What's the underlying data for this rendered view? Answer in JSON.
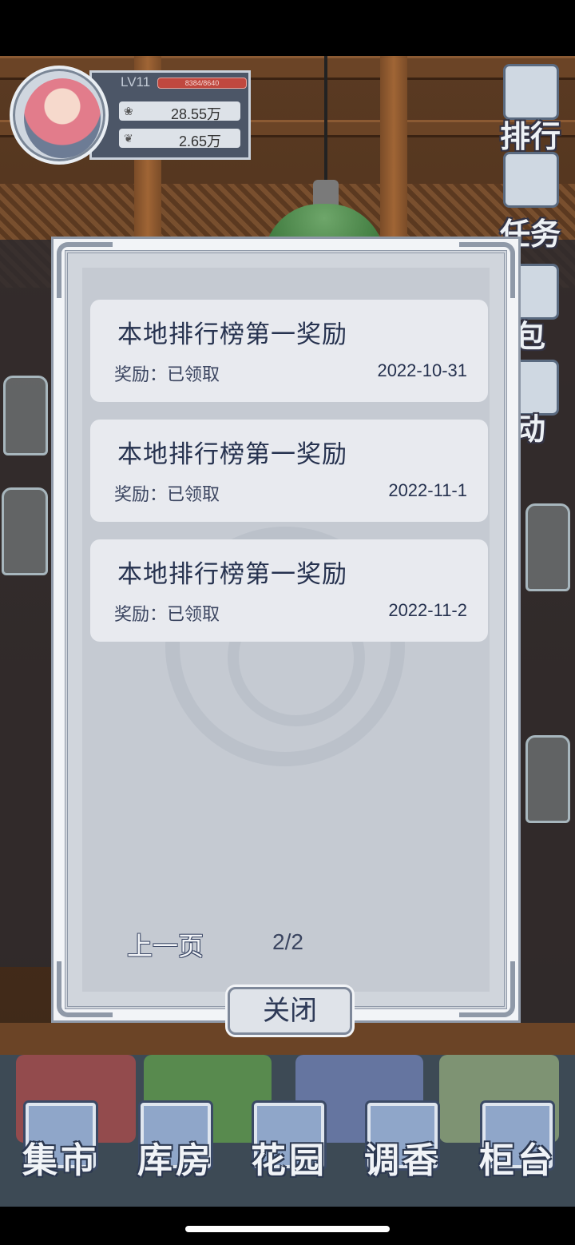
{
  "hud": {
    "level": "LV11",
    "xp_text": "8384/8640",
    "xp_fraction": 0.97,
    "currency_1": "28.55万",
    "currency_2": "2.65万"
  },
  "side_menu": [
    {
      "label": "排行",
      "icon": "trophy-icon"
    },
    {
      "label": "任务",
      "icon": "clipboard-icon"
    },
    {
      "label": "包",
      "icon": "bag-icon"
    },
    {
      "label": "动",
      "icon": "event-icon"
    }
  ],
  "dialog": {
    "items": [
      {
        "title": "本地排行榜第一奖励",
        "status": "奖励：已领取",
        "date": "2022-10-31"
      },
      {
        "title": "本地排行榜第一奖励",
        "status": "奖励：已领取",
        "date": "2022-11-1"
      },
      {
        "title": "本地排行榜第一奖励",
        "status": "奖励：已领取",
        "date": "2022-11-2"
      }
    ],
    "prev_page": "上一页",
    "page_indicator": "2/2",
    "close_label": "关闭"
  },
  "bottom_nav": [
    {
      "label": "集市",
      "icon": "market-gate-icon"
    },
    {
      "label": "库房",
      "icon": "warehouse-icon"
    },
    {
      "label": "花园",
      "icon": "rose-icon"
    },
    {
      "label": "调香",
      "icon": "perfume-icon"
    },
    {
      "label": "柜台",
      "icon": "counter-bottles-icon"
    }
  ]
}
